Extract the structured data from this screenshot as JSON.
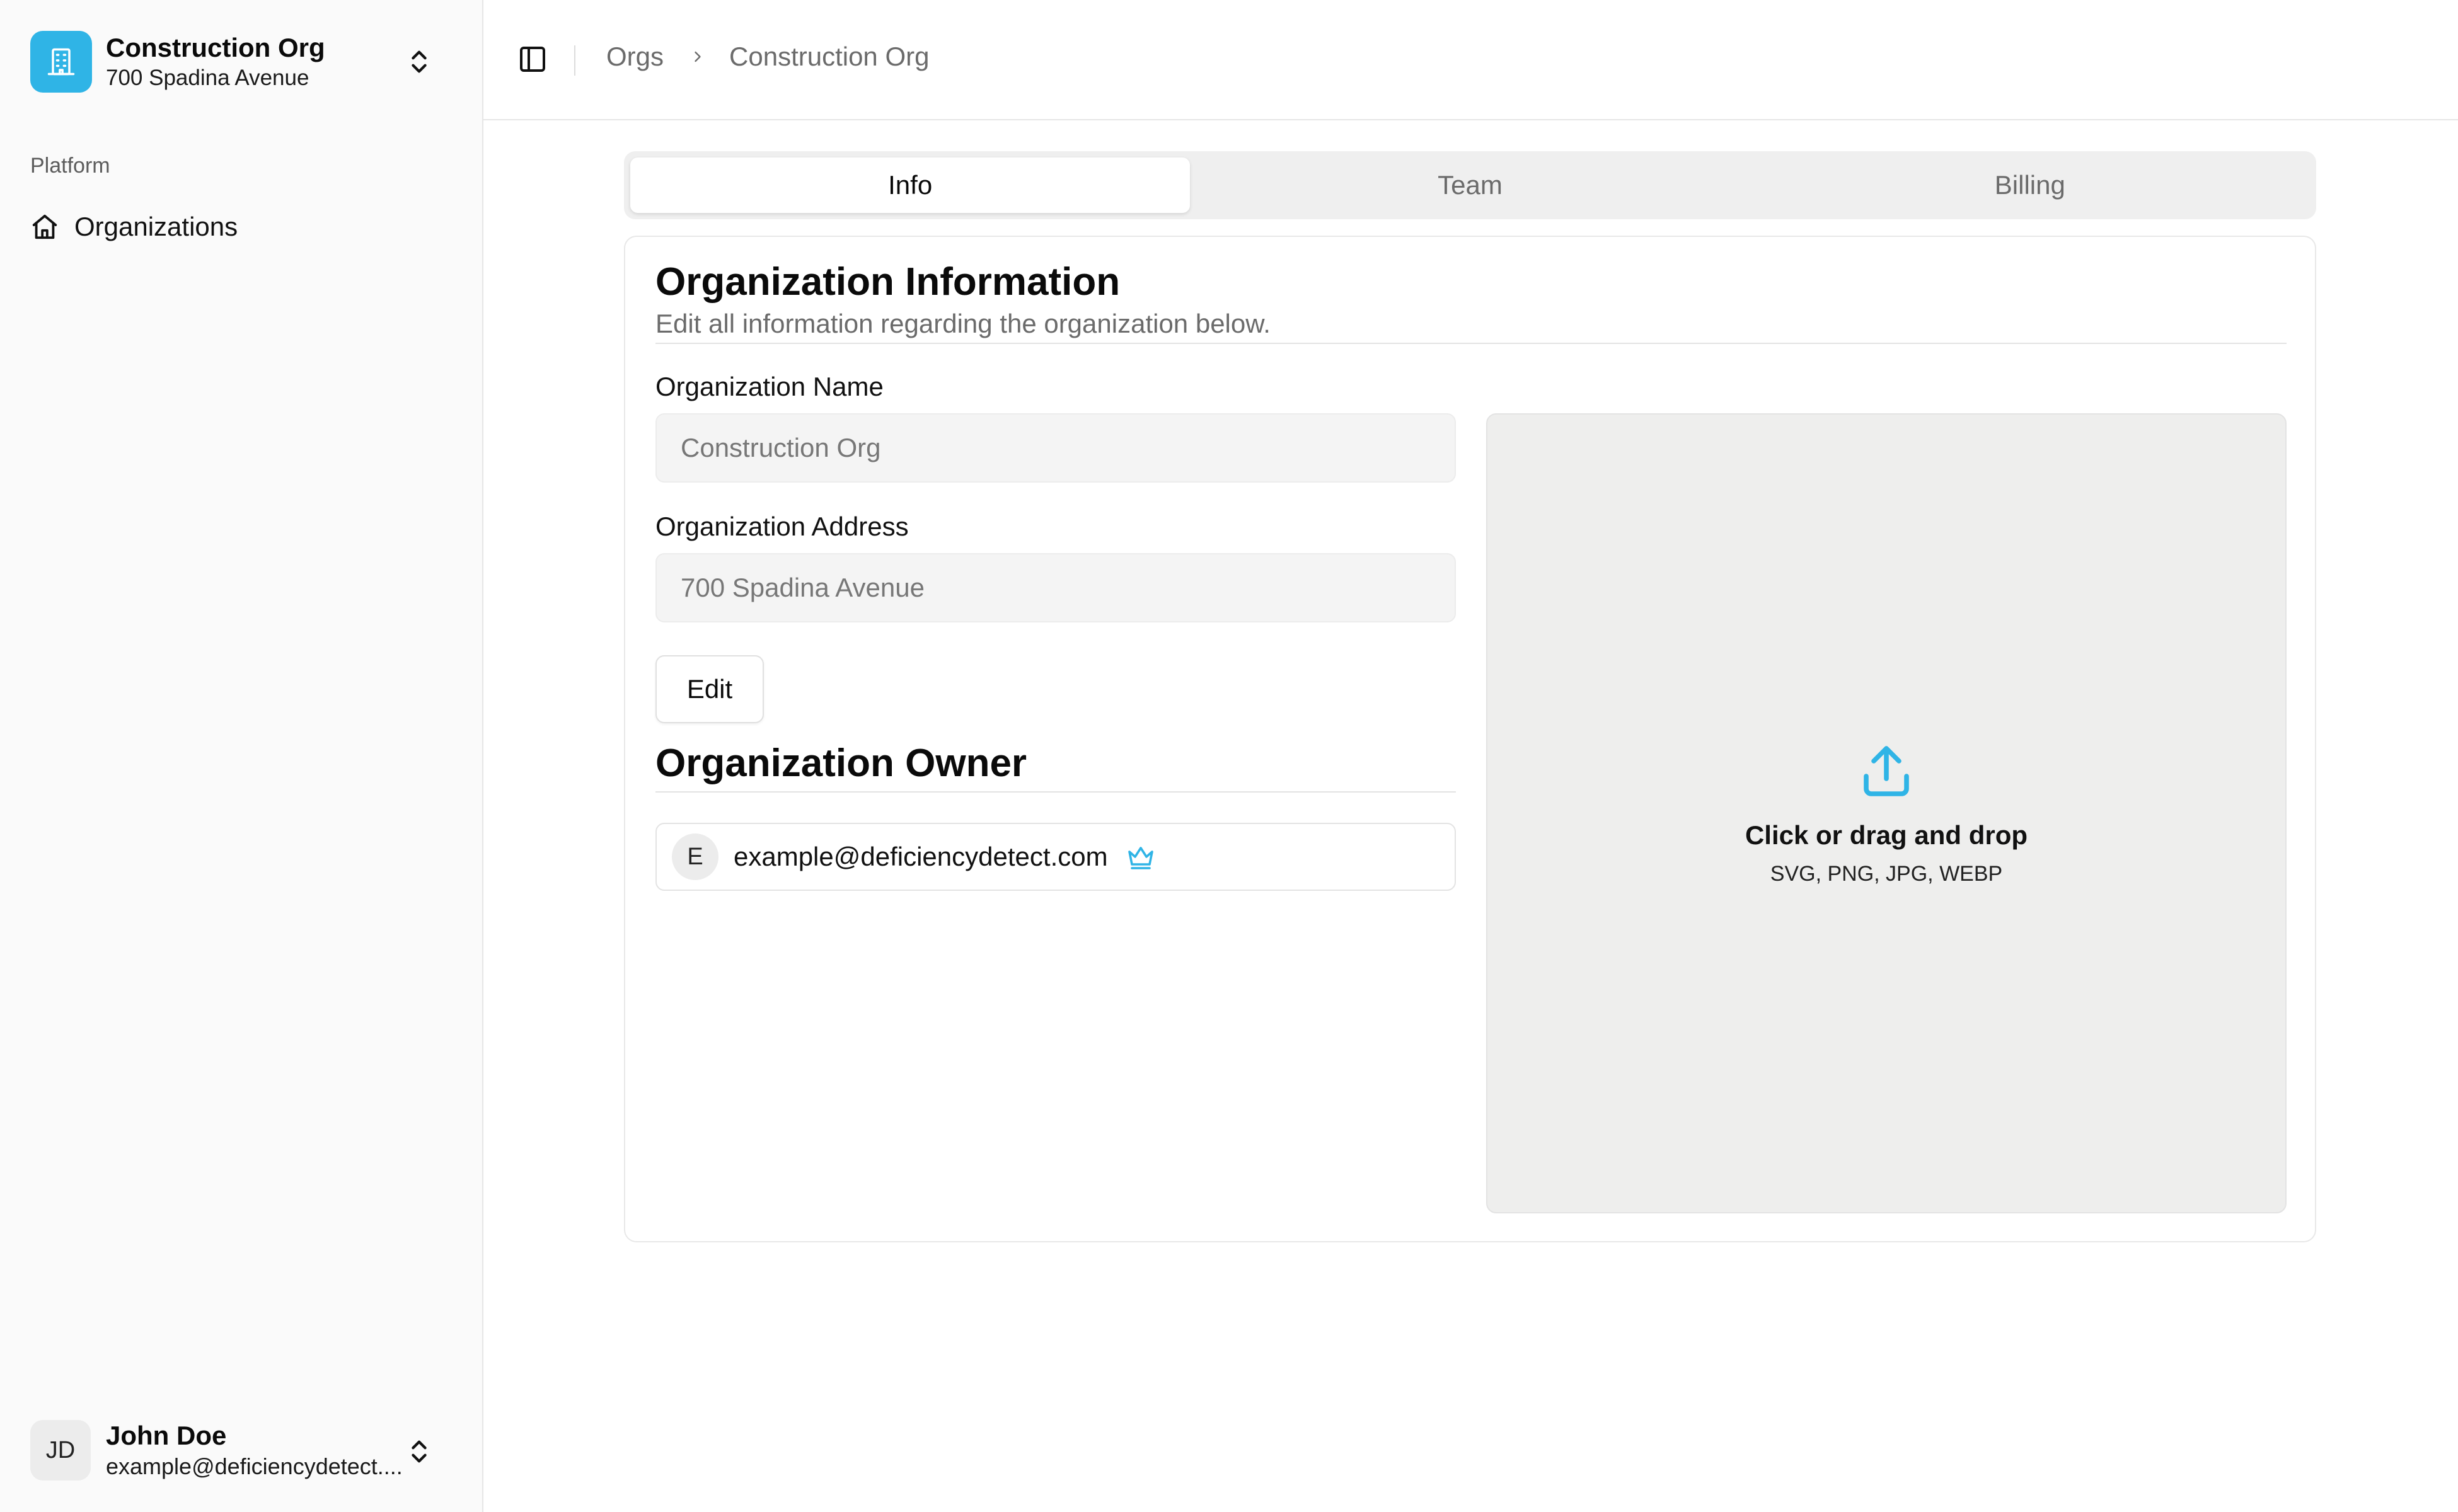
{
  "org_switcher": {
    "name": "Construction Org",
    "address": "700 Spadina Avenue",
    "icon": "building-icon"
  },
  "sidebar": {
    "section_label": "Platform",
    "items": [
      {
        "label": "Organizations",
        "icon": "home-icon"
      }
    ]
  },
  "user": {
    "initials": "JD",
    "name": "John Doe",
    "email": "example@deficiencydetect...."
  },
  "breadcrumb": {
    "items": [
      "Orgs",
      "Construction Org"
    ]
  },
  "tabs": [
    {
      "label": "Info",
      "active": true
    },
    {
      "label": "Team",
      "active": false
    },
    {
      "label": "Billing",
      "active": false
    }
  ],
  "info_card": {
    "title": "Organization Information",
    "description": "Edit all information regarding the organization below.",
    "name_label": "Organization Name",
    "name_value": "Construction Org",
    "address_label": "Organization Address",
    "address_value": "700 Spadina Avenue",
    "edit_label": "Edit",
    "owner_title": "Organization Owner",
    "owner_initial": "E",
    "owner_email": "example@deficiencydetect.com"
  },
  "dropzone": {
    "title": "Click or drag and drop",
    "formats": "SVG, PNG, JPG, WEBP"
  },
  "colors": {
    "accent": "#2fb4e6",
    "sidebar_bg": "#fafafa",
    "dropzone_bg": "#eeeeed"
  }
}
